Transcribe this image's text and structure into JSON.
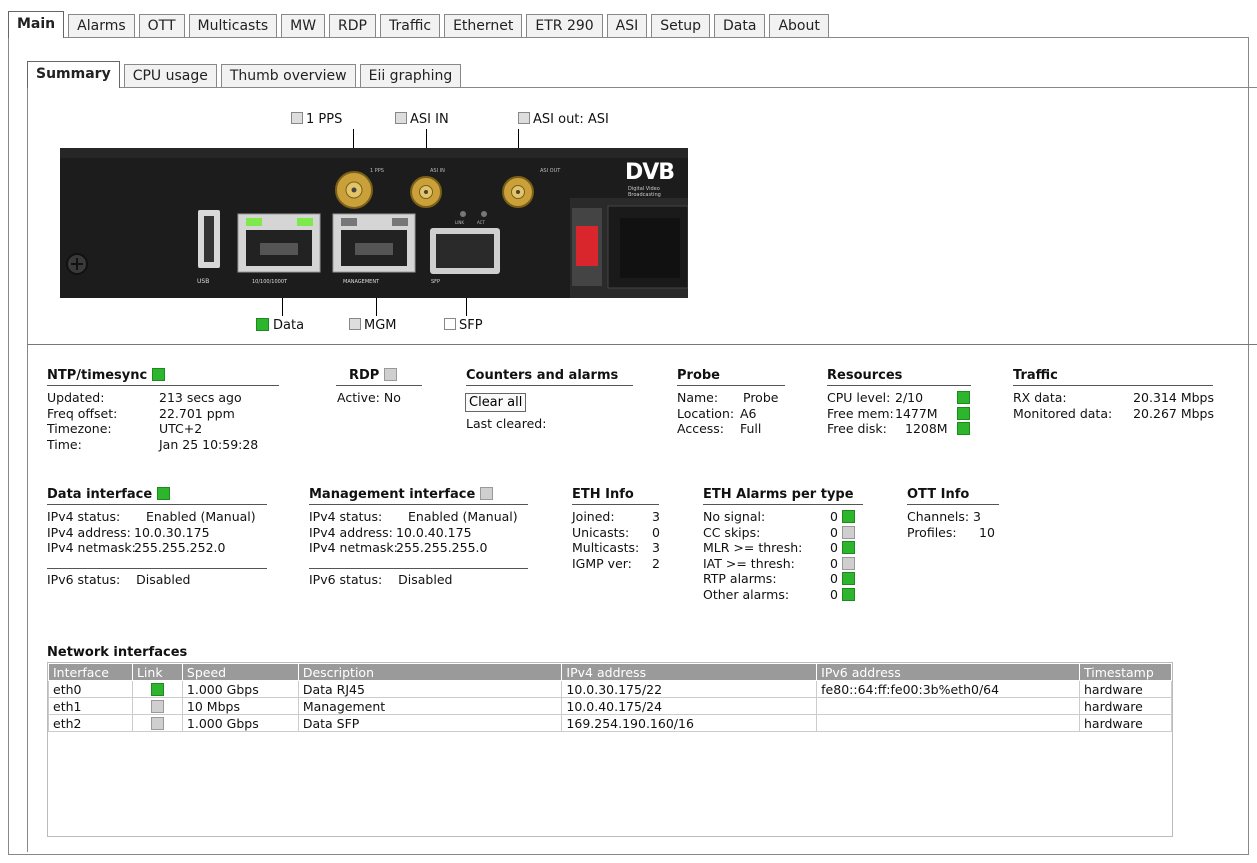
{
  "main_tabs": [
    "Main",
    "Alarms",
    "OTT",
    "Multicasts",
    "MW",
    "RDP",
    "Traffic",
    "Ethernet",
    "ETR 290",
    "ASI",
    "Setup",
    "Data",
    "About"
  ],
  "sub_tabs": [
    "Summary",
    "CPU usage",
    "Thumb overview",
    "Eii graphing"
  ],
  "device": {
    "top_labels": {
      "pps": "1 PPS",
      "asi_in": "ASI IN",
      "asi_out": "ASI out: ASI"
    },
    "bottom_labels": {
      "data": "Data",
      "mgm": "MGM",
      "sfp": "SFP"
    },
    "panel_labels": {
      "usb": "USB",
      "data_port": "10/100/1000T",
      "mgmt_port": "MANAGEMENT",
      "sfp": "SFP",
      "pps": "1 PPS",
      "asi_in": "ASI IN",
      "asi_out": "ASI OUT",
      "link": "LINK",
      "act": "ACT"
    },
    "logo": "DVB",
    "logo_sub": "Digital Video Broadcasting"
  },
  "ntp": {
    "title": "NTP/timesync",
    "status_color": "#2db52d",
    "rows": [
      {
        "k": "Updated:",
        "v": "213 secs ago"
      },
      {
        "k": "Freq offset:",
        "v": "22.701 ppm"
      },
      {
        "k": "Timezone:",
        "v": "UTC+2"
      },
      {
        "k": "Time:",
        "v": "Jan 25 10:59:28"
      }
    ]
  },
  "rdp": {
    "title": "RDP",
    "active_k": "Active:",
    "active_v": "No"
  },
  "counters": {
    "title": "Counters and alarms",
    "clear_label": "Clear all",
    "last_cleared": "Last cleared:"
  },
  "probe": {
    "title": "Probe",
    "rows": [
      {
        "k": "Name:",
        "v": "Probe"
      },
      {
        "k": "Location:",
        "v": "A6"
      },
      {
        "k": "Access:",
        "v": "Full"
      }
    ]
  },
  "resources": {
    "title": "Resources",
    "rows": [
      {
        "k": "CPU level:",
        "v": "2/10"
      },
      {
        "k": "Free mem:",
        "v": "1477M"
      },
      {
        "k": "Free disk:",
        "v": "1208M"
      }
    ]
  },
  "traffic": {
    "title": "Traffic",
    "rows": [
      {
        "k": "RX data:",
        "v": "20.314 Mbps"
      },
      {
        "k": "Monitored data:",
        "v": "20.267 Mbps"
      }
    ]
  },
  "data_if": {
    "title": "Data interface",
    "rows": [
      {
        "k": "IPv4 status:",
        "v": "Enabled (Manual)"
      },
      {
        "k": "IPv4 address:",
        "v": "10.0.30.175"
      },
      {
        "k": "IPv4 netmask:",
        "v": "255.255.252.0"
      },
      {
        "k": "IPv6 status:",
        "v": "Disabled"
      }
    ]
  },
  "mgmt_if": {
    "title": "Management interface",
    "rows": [
      {
        "k": "IPv4 status:",
        "v": "Enabled (Manual)"
      },
      {
        "k": "IPv4 address:",
        "v": "10.0.40.175"
      },
      {
        "k": "IPv4 netmask:",
        "v": "255.255.255.0"
      },
      {
        "k": "IPv6 status:",
        "v": "Disabled"
      }
    ]
  },
  "eth_info": {
    "title": "ETH Info",
    "rows": [
      {
        "k": "Joined:",
        "v": "3"
      },
      {
        "k": "Unicasts:",
        "v": "0"
      },
      {
        "k": "Multicasts:",
        "v": "3"
      },
      {
        "k": "IGMP ver:",
        "v": "2"
      }
    ]
  },
  "eth_alarms": {
    "title": "ETH Alarms per type",
    "rows": [
      {
        "k": "No signal:",
        "v": "0",
        "led": "green"
      },
      {
        "k": "CC skips:",
        "v": "0",
        "led": "grey"
      },
      {
        "k": "MLR >= thresh:",
        "v": "0",
        "led": "green"
      },
      {
        "k": "IAT >= thresh:",
        "v": "0",
        "led": "grey"
      },
      {
        "k": "RTP alarms:",
        "v": "0",
        "led": "green"
      },
      {
        "k": "Other alarms:",
        "v": "0",
        "led": "green"
      }
    ]
  },
  "ott_info": {
    "title": "OTT Info",
    "rows": [
      {
        "k": "Channels:",
        "v": "3"
      },
      {
        "k": "Profiles:",
        "v": "10"
      }
    ]
  },
  "network": {
    "title": "Network interfaces",
    "columns": [
      "Interface",
      "Link",
      "Speed",
      "Description",
      "IPv4 address",
      "IPv6 address",
      "Timestamp"
    ],
    "rows": [
      {
        "iface": "eth0",
        "link": "green",
        "speed": "1.000 Gbps",
        "desc": "Data RJ45",
        "ipv4": "10.0.30.175/22",
        "ipv6": "fe80::64:ff:fe00:3b%eth0/64",
        "ts": "hardware"
      },
      {
        "iface": "eth1",
        "link": "grey",
        "speed": "10 Mbps",
        "desc": "Management",
        "ipv4": "10.0.40.175/24",
        "ipv6": "",
        "ts": "hardware"
      },
      {
        "iface": "eth2",
        "link": "grey",
        "speed": "1.000 Gbps",
        "desc": "Data SFP",
        "ipv4": "169.254.190.160/16",
        "ipv6": "",
        "ts": "hardware"
      }
    ]
  }
}
